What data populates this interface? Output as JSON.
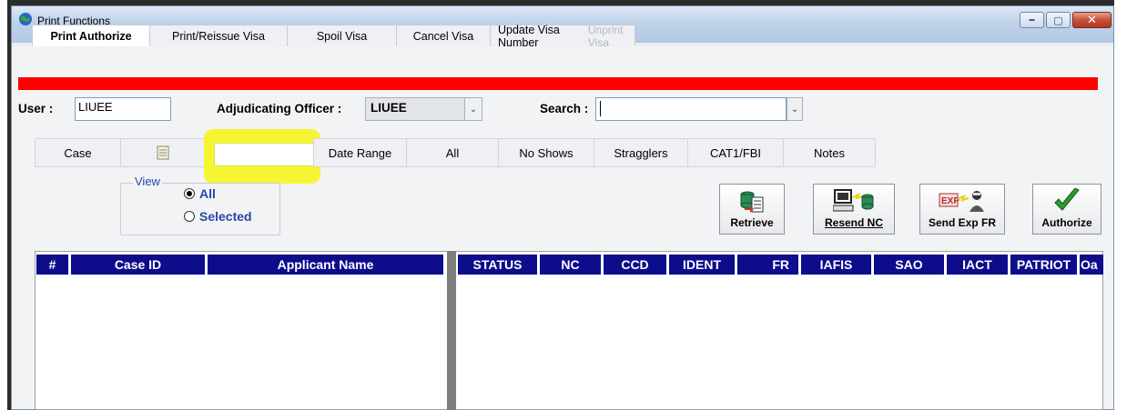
{
  "window": {
    "title": "Print Functions",
    "controls": {
      "minimize": "▬",
      "maximize": "▢",
      "close": "✕"
    }
  },
  "top_tabs": [
    {
      "label": "Print Authorize",
      "state": "active"
    },
    {
      "label": "Print/Reissue Visa",
      "state": "normal"
    },
    {
      "label": "Spoil Visa",
      "state": "normal"
    },
    {
      "label": "Cancel Visa",
      "state": "normal"
    },
    {
      "label": "Update Visa Number",
      "state": "normal"
    },
    {
      "label": "Unprint Visa",
      "state": "disabled"
    }
  ],
  "form": {
    "user_label": "User :",
    "user_value": "LIUEE",
    "officer_label": "Adjudicating Officer :",
    "officer_value": "LIUEE",
    "search_label": "Search :",
    "search_value": ""
  },
  "sub_tabs": [
    {
      "label": "Case"
    },
    {
      "label": "Date Range"
    },
    {
      "label": "All"
    },
    {
      "label": "No Shows"
    },
    {
      "label": "Stragglers"
    },
    {
      "label": "CAT1/FBI"
    },
    {
      "label": "Notes"
    }
  ],
  "view": {
    "title": "View",
    "options": [
      {
        "label": "All",
        "selected": true
      },
      {
        "label": "Selected",
        "selected": false
      }
    ]
  },
  "actions": {
    "retrieve": "Retrieve",
    "resend_nc": "Resend NC",
    "send_exp_fr": "Send Exp FR",
    "authorize": "Authorize"
  },
  "grid": {
    "left_columns": [
      "#",
      "Case ID",
      "Applicant Name"
    ],
    "right_columns": [
      "STATUS",
      "NC",
      "CCD",
      "IDENT",
      "FR",
      "IAFIS",
      "SAO",
      "IACT",
      "PATRIOT",
      "Oa"
    ]
  },
  "colors": {
    "alert_bar": "#ff0000",
    "grid_header": "#0d0d8c",
    "highlight": "#f5f51e",
    "view_text": "#2a46a8"
  }
}
